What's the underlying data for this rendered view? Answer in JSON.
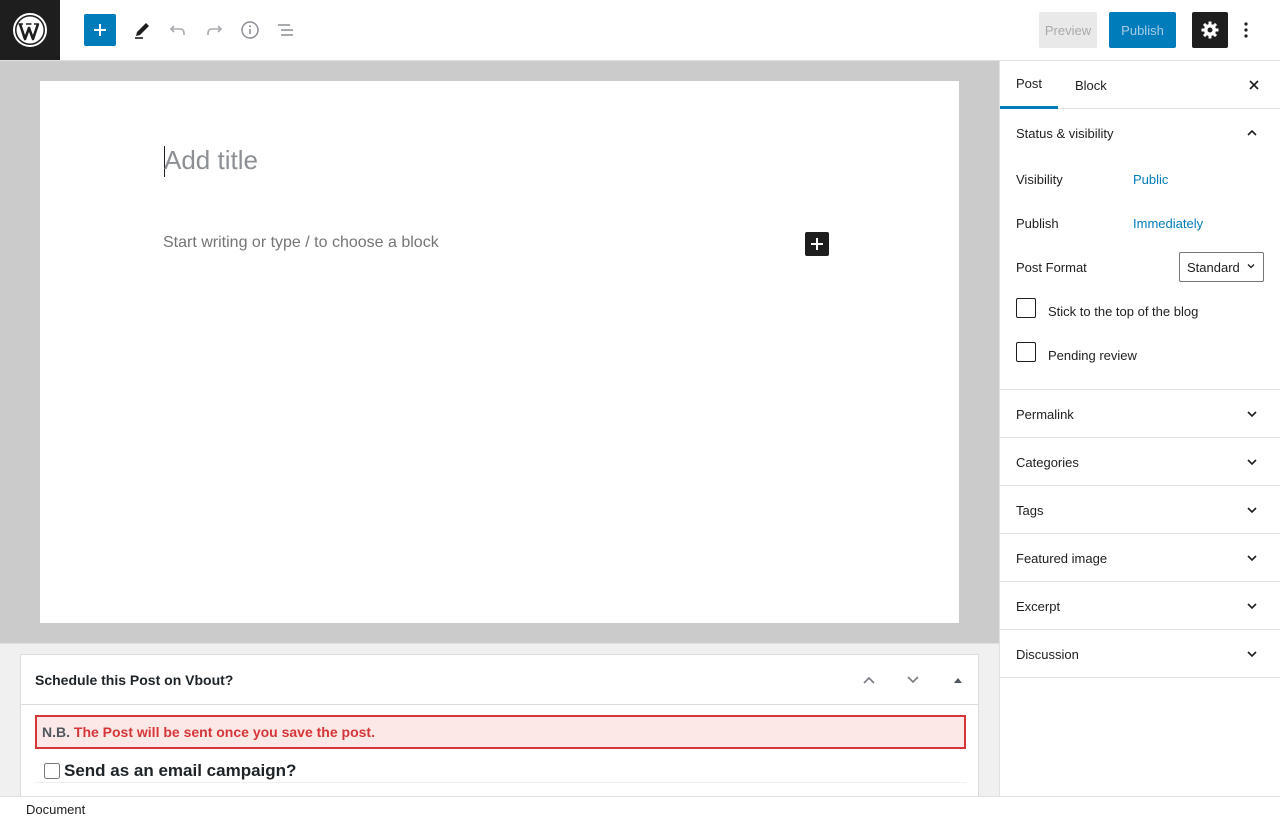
{
  "toolbar": {
    "preview_label": "Preview",
    "publish_label": "Publish"
  },
  "editor": {
    "title_placeholder": "Add title",
    "block_placeholder": "Start writing or type / to choose a block"
  },
  "metabox": {
    "title": "Schedule this Post on Vbout?",
    "notice_prefix": "N.B.",
    "notice_message": "The Post will be sent once you save the post.",
    "email_label": "Send as an email campaign?"
  },
  "footer": {
    "breadcrumb": "Document"
  },
  "sidebar": {
    "tabs": [
      {
        "label": "Post",
        "active": true
      },
      {
        "label": "Block",
        "active": false
      }
    ],
    "status_panel": {
      "title": "Status & visibility",
      "visibility_label": "Visibility",
      "visibility_value": "Public",
      "publish_label": "Publish",
      "publish_value": "Immediately",
      "format_label": "Post Format",
      "format_value": "Standard",
      "sticky_label": "Stick to the top of the blog",
      "pending_label": "Pending review"
    },
    "panels": [
      {
        "title": "Permalink"
      },
      {
        "title": "Categories"
      },
      {
        "title": "Tags"
      },
      {
        "title": "Featured image"
      },
      {
        "title": "Excerpt"
      },
      {
        "title": "Discussion"
      }
    ]
  },
  "colors": {
    "accent": "#007cba",
    "dark": "#1e1e1e",
    "error": "#d63638"
  }
}
